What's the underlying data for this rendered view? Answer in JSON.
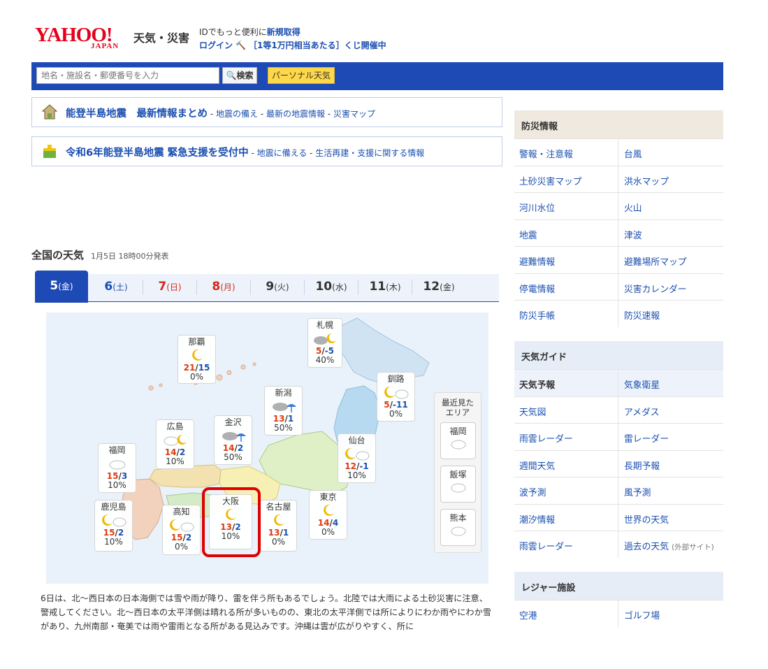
{
  "header": {
    "logo_text": "YAHOO!",
    "logo_sub": "JAPAN",
    "site_name": "天気・災害",
    "line1_prefix": "IDでもっと便利に",
    "line1_link": "新規取得",
    "login": "ログイン",
    "lottery": "［1等1万円相当あたる］くじ開催中"
  },
  "search": {
    "placeholder": "地名・施設名・郵便番号を入力",
    "button": "検索",
    "personal": "パーソナル天気"
  },
  "alerts": [
    {
      "title": "能登半島地震　最新情報まとめ",
      "links": [
        "地震の備え",
        "最新の地震情報",
        "災害マップ"
      ]
    },
    {
      "title": "令和6年能登半島地震 緊急支援を受付中",
      "links": [
        "地震に備える",
        "生活再建・支援に関する情報"
      ]
    }
  ],
  "section": {
    "title": "全国の天気",
    "issued": "1月5日 18時00分発表"
  },
  "tabs": [
    {
      "day": "5",
      "dow": "(金)"
    },
    {
      "day": "6",
      "dow": "(土)"
    },
    {
      "day": "7",
      "dow": "(日)"
    },
    {
      "day": "8",
      "dow": "(月)"
    },
    {
      "day": "9",
      "dow": "(火)"
    },
    {
      "day": "10",
      "dow": "(水)"
    },
    {
      "day": "11",
      "dow": "(木)"
    },
    {
      "day": "12",
      "dow": "(金)"
    }
  ],
  "cities": [
    {
      "name": "那覇",
      "hi": "21",
      "lo": "15",
      "pop": "0%",
      "icon": "moon-icon"
    },
    {
      "name": "札幌",
      "hi": "5",
      "lo": "-5",
      "pop": "40%",
      "icon": "cloud-moon-icon"
    },
    {
      "name": "釧路",
      "hi": "5",
      "lo": "-11",
      "pop": "0%",
      "icon": "moon-cloud-icon"
    },
    {
      "name": "新潟",
      "hi": "13",
      "lo": "1",
      "pop": "50%",
      "icon": "cloud-umbrella-icon"
    },
    {
      "name": "金沢",
      "hi": "14",
      "lo": "2",
      "pop": "50%",
      "icon": "cloud-umbrella-icon"
    },
    {
      "name": "広島",
      "hi": "14",
      "lo": "2",
      "pop": "10%",
      "icon": "cloud-moon-icon"
    },
    {
      "name": "仙台",
      "hi": "12",
      "lo": "-1",
      "pop": "10%",
      "icon": "moon-cloud-icon"
    },
    {
      "name": "福岡",
      "hi": "15",
      "lo": "3",
      "pop": "10%",
      "icon": "cloud-icon"
    },
    {
      "name": "東京",
      "hi": "14",
      "lo": "4",
      "pop": "0%",
      "icon": "moon-icon"
    },
    {
      "name": "鹿児島",
      "hi": "15",
      "lo": "2",
      "pop": "10%",
      "icon": "moon-cloud-icon"
    },
    {
      "name": "高知",
      "hi": "15",
      "lo": "2",
      "pop": "0%",
      "icon": "moon-cloud-icon"
    },
    {
      "name": "大阪",
      "hi": "13",
      "lo": "2",
      "pop": "10%",
      "icon": "moon-icon"
    },
    {
      "name": "名古屋",
      "hi": "13",
      "lo": "1",
      "pop": "0%",
      "icon": "moon-icon"
    }
  ],
  "recent": {
    "title1": "最近見た",
    "title2": "エリア",
    "areas": [
      "福岡",
      "飯塚",
      "熊本"
    ]
  },
  "description": "6日は、北～西日本の日本海側では雪や雨が降り、雷を伴う所もあるでしょう。北陸では大雨による土砂災害に注意、警戒してください。北～西日本の太平洋側は晴れる所が多いものの、東北の太平洋側では所によりにわか雨やにわか雪があり、九州南部・奄美では雨や雷雨となる所がある見込みです。沖縄は雲が広がりやすく、所に",
  "sidebar": {
    "disaster": {
      "title": "防災情報",
      "rows": [
        [
          "警報・注意報",
          "台風"
        ],
        [
          "土砂災害マップ",
          "洪水マップ"
        ],
        [
          "河川水位",
          "火山"
        ],
        [
          "地震",
          "津波"
        ],
        [
          "避難情報",
          "避難場所マップ"
        ],
        [
          "停電情報",
          "災害カレンダー"
        ],
        [
          "防災手帳",
          "防災速報"
        ]
      ]
    },
    "guide": {
      "title": "天気ガイド",
      "rows": [
        [
          "天気予報",
          "気象衛星"
        ],
        [
          "天気図",
          "アメダス"
        ],
        [
          "雨雲レーダー",
          "雷レーダー"
        ],
        [
          "週間天気",
          "長期予報"
        ],
        [
          "波予測",
          "風予測"
        ],
        [
          "潮汐情報",
          "世界の天気"
        ],
        [
          "雨雲レーダー",
          "過去の天気"
        ]
      ],
      "ext_note": "(外部サイト)"
    },
    "leisure": {
      "title": "レジャー施設",
      "rows": [
        [
          "空港",
          "ゴルフ場"
        ]
      ]
    }
  },
  "colors": {
    "brand": "#1e4ab6",
    "accent": "#ffd84a",
    "highlight": "#e00000"
  }
}
